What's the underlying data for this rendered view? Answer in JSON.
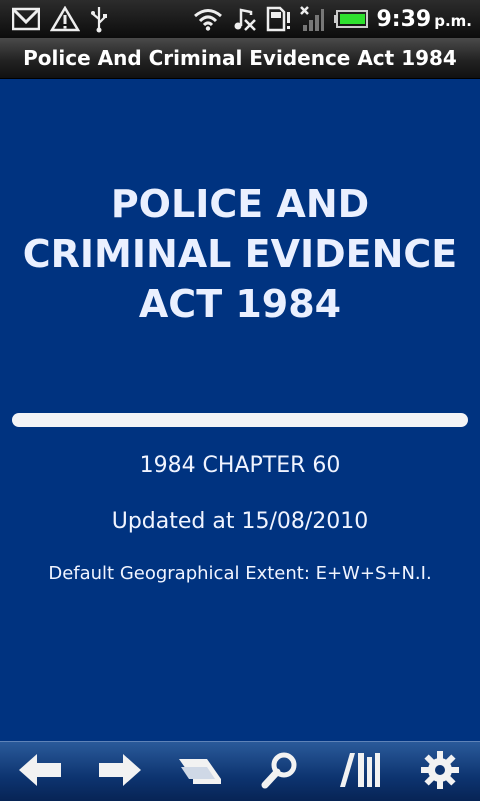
{
  "status_bar": {
    "icons": [
      "gmail-icon",
      "warning-icon",
      "usb-icon",
      "wifi-icon",
      "music-off-icon",
      "sd-card-alert-icon",
      "signal-icon",
      "battery-icon"
    ],
    "time": "9:39",
    "ampm": "p.m."
  },
  "header": {
    "title": "Police And Criminal Evidence Act 1984"
  },
  "document": {
    "title_lines": [
      "POLICE AND",
      "CRIMINAL EVIDENCE",
      "ACT 1984"
    ],
    "chapter": "1984 CHAPTER 60",
    "updated": "Updated at 15/08/2010",
    "extent": "Default Geographical Extent: E+W+S+N.I."
  },
  "toolbar": {
    "buttons": [
      "back-icon",
      "forward-icon",
      "contents-icon",
      "search-icon",
      "library-icon",
      "settings-icon"
    ]
  },
  "colors": {
    "background": "#003380",
    "toolbar": "#0d3470",
    "text": "#eaf0ff"
  }
}
